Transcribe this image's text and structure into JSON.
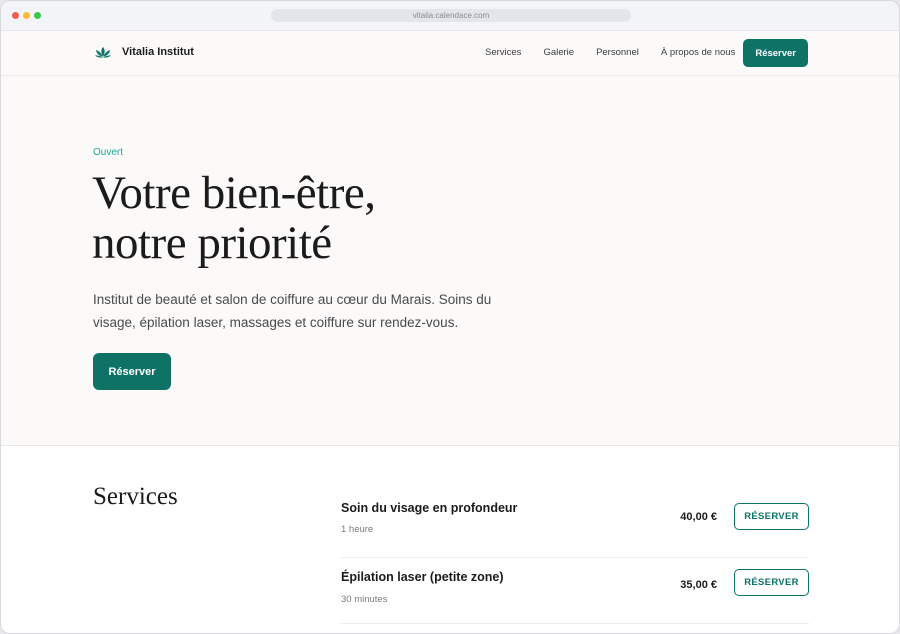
{
  "browser": {
    "url": "vitalia.calendace.com"
  },
  "nav": {
    "brand": "Vitalia Institut",
    "links": [
      "Services",
      "Galerie",
      "Personnel",
      "À propos de nous"
    ],
    "cta": "Réserver"
  },
  "hero": {
    "status": "Ouvert",
    "title_line1": "Votre bien-être,",
    "title_line2": "notre priorité",
    "description": "Institut de beauté et salon de coiffure au cœur du Marais. Soins du visage, épilation laser, massages et coiffure sur rendez-vous.",
    "cta": "Réserver"
  },
  "services": {
    "heading": "Services",
    "items": [
      {
        "name": "Soin du visage en profondeur",
        "duration": "1 heure",
        "price": "40,00 €",
        "action": "RÉSERVER"
      },
      {
        "name": "Épilation laser (petite zone)",
        "duration": "30 minutes",
        "price": "35,00 €",
        "action": "RÉSERVER"
      }
    ]
  },
  "colors": {
    "accent": "#0e7267",
    "status": "#1aa79a",
    "background": "#fbfaf8"
  },
  "icons": {
    "brand": "lotus-icon"
  }
}
